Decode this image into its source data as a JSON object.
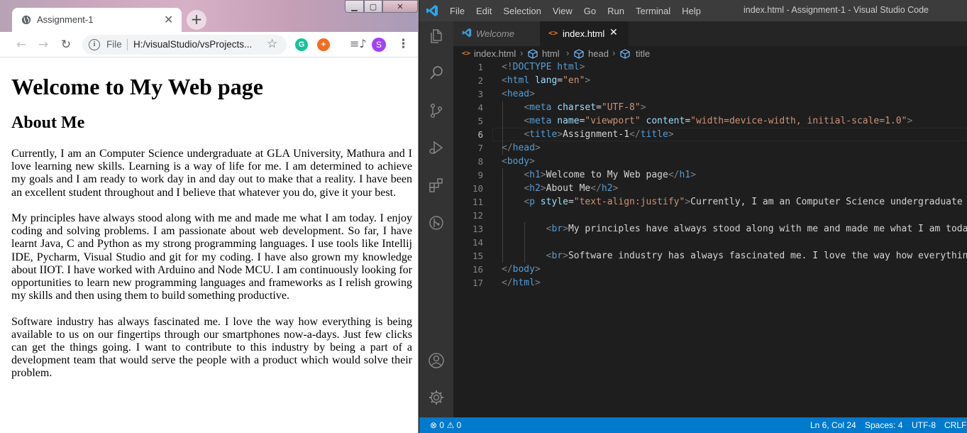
{
  "chrome": {
    "tab_title": "Assignment-1",
    "new_tab_symbol": "+",
    "omnibox": {
      "scheme_label": "File",
      "url": "H:/visualStudio/vsProjects..."
    },
    "profile_initial": "S",
    "extensions": [
      "G",
      "+"
    ]
  },
  "page": {
    "h1": "Welcome to My Web page",
    "h2": "About Me",
    "paragraphs": [
      "Currently, I am an Computer Science undergraduate at GLA University, Mathura and I love learning new skills. Learning is a way of life for me. I am determined to achieve my goals and I am ready to work day in and day out to make that a reality. I have been an excellent student throughout and I believe that whatever you do, give it your best.",
      "My principles have always stood along with me and made me what I am today. I enjoy coding and solving problems. I am passionate about web development. So far, I have learnt Java, C and Python as my strong programming languages. I use tools like Intellij IDE, Pycharm, Visual Studio and git for my coding. I have also grown my knowledge about IIOT. I have worked with Arduino and Node MCU. I am continuously looking for opportunities to learn new programming languages and frameworks as I relish growing my skills and then using them to build something productive.",
      "Software industry has always fascinated me. I love the way how everything is being available to us on our fingertips through our smartphones now-a-days. Just few clicks can get the things going. I want to contribute to this industry by being a part of a development team that would serve the people with a product which would solve their problem."
    ]
  },
  "vscode": {
    "window_title": "index.html - Assignment-1 - Visual Studio Code",
    "menu": [
      "File",
      "Edit",
      "Selection",
      "View",
      "Go",
      "Run",
      "Terminal",
      "Help"
    ],
    "tabs": [
      {
        "label": "Welcome",
        "active": false
      },
      {
        "label": "index.html",
        "active": true,
        "close": "✕"
      }
    ],
    "breadcrumbs": [
      "index.html",
      "html",
      "head",
      "title"
    ],
    "line_numbers": [
      "1",
      "2",
      "3",
      "4",
      "5",
      "6",
      "7",
      "8",
      "9",
      "10",
      "11",
      "12",
      "13",
      "14",
      "15",
      "16",
      "17"
    ],
    "code_lines": [
      "<!DOCTYPE html>",
      "<html lang=\"en\">",
      "<head>",
      "    <meta charset=\"UTF-8\">",
      "    <meta name=\"viewport\" content=\"width=device-width, initial-scale=1.0\">",
      "    <title>Assignment-1</title>",
      "</head>",
      "<body>",
      "    <h1>Welcome to My Web page</h1>",
      "    <h2>About Me</h2>",
      "    <p style=\"text-align:justify\">Currently, I am an Computer Science undergraduate at",
      "",
      "        <br>My principles have always stood along with me and made me what I am today",
      "",
      "        <br>Software industry has always fascinated me. I love the way how everything",
      "</body>",
      "</html>"
    ],
    "status": {
      "errors": "0",
      "warnings": "0",
      "position": "Ln 6, Col 24",
      "spaces": "Spaces: 4",
      "encoding": "UTF-8",
      "eol": "CRLF"
    }
  },
  "colors": {
    "vscode_blue": "#007acc",
    "tag": "#569cd6",
    "attr": "#9cdcfe",
    "string": "#ce9178",
    "punct": "#808080"
  }
}
